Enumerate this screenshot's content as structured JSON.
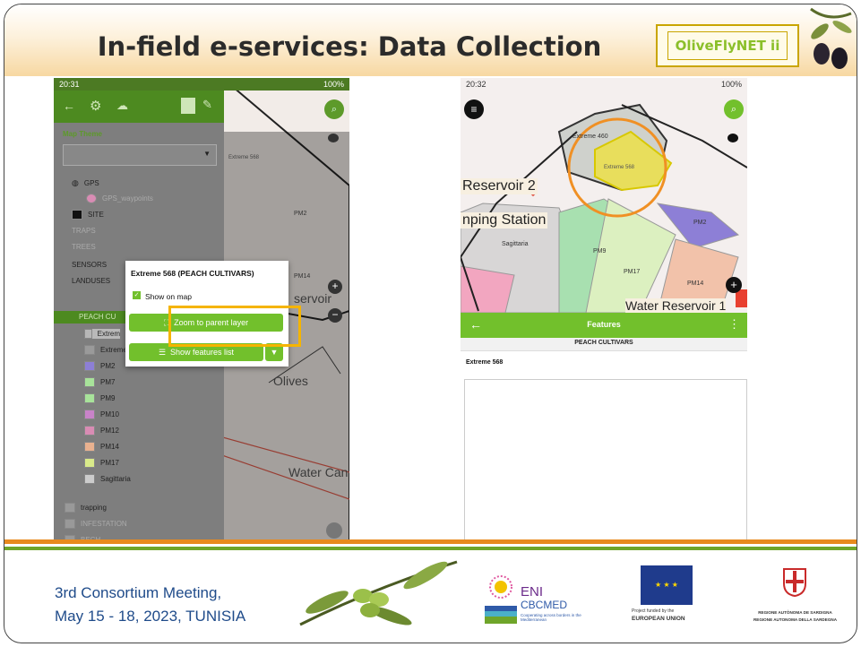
{
  "header": {
    "title": "In-field e-services: Data Collection",
    "brand": "OliveFlyNET ii"
  },
  "left_phone": {
    "status_time": "20:31",
    "status_icons": "G",
    "status_battery": "100%",
    "map_theme_label": "Map Theme",
    "layers": [
      {
        "label": "GPS",
        "dim": false
      },
      {
        "label": "GPS_waypoints",
        "dim": true
      },
      {
        "label": "SITE",
        "dim": false
      },
      {
        "label": "TRAPS",
        "dim": true
      },
      {
        "label": "TREES",
        "dim": true
      },
      {
        "label": "SENSORS",
        "dim": false
      },
      {
        "label": "LANDUSES",
        "dim": false
      }
    ],
    "peach_layer": "PEACH CU",
    "sublayers": [
      "Extrem",
      "Extreme",
      "PM2",
      "PM7",
      "PM9",
      "PM10",
      "PM12",
      "PM14",
      "PM17",
      "Sagittaria"
    ],
    "sublayer_colors": [
      "#b7b7b7",
      "#9a9a9a",
      "#8d7fd6",
      "#a8e39a",
      "#a8e39a",
      "#c983c9",
      "#d98cb4",
      "#e9b18f",
      "#d9ea8a",
      "#cccccc"
    ],
    "bottom_layers": [
      "trapping",
      "INFESTATION",
      "BECH"
    ],
    "map_labels": {
      "pm2": "PM2",
      "pm14": "PM14",
      "olives": "Olives",
      "water": "Water Can",
      "reservoir": "servoir",
      "extreme": "Extreme 568"
    },
    "popup": {
      "title": "Extreme 568 (PEACH CULTIVARS)",
      "show_on_map": "Show on map",
      "zoom": "Zoom to parent layer",
      "features": "Show features list"
    }
  },
  "right_phone": {
    "status_time": "20:32",
    "status_icons": "G",
    "status_battery": "100%",
    "map_labels": {
      "extreme460": "Extreme 460",
      "extreme568": "Extreme 568",
      "reservoir2": "Reservoir 2",
      "pumping": "nping Station",
      "sagittaria": "Sagittaria",
      "pm9": "PM9",
      "pm17": "PM17",
      "pm2": "PM2",
      "pm14": "PM14",
      "water": "Water Reservoir 1"
    },
    "appbar_title": "Features",
    "section": "PEACH CULTIVARS",
    "feature": "Extreme 568"
  },
  "footer": {
    "line1": "3rd Consortium Meeting,",
    "line2": "May 15 - 18, 2023, TUNISIA",
    "eni": "ENI",
    "cbcmed": "CBCMED",
    "eni_sub": "Cooperating across borders in the Mediterranean",
    "eu_small": "Project funded by the",
    "eu": "EUROPEAN UNION",
    "sardegna1": "REGIONE AUTÒNOMA DE SARDIGNA",
    "sardegna2": "REGIONE AUTONOMA DELLA SARDEGNA"
  },
  "colors": {
    "accent": "#72c02c",
    "orange": "#e88a1e",
    "highlight": "#f5b400"
  }
}
